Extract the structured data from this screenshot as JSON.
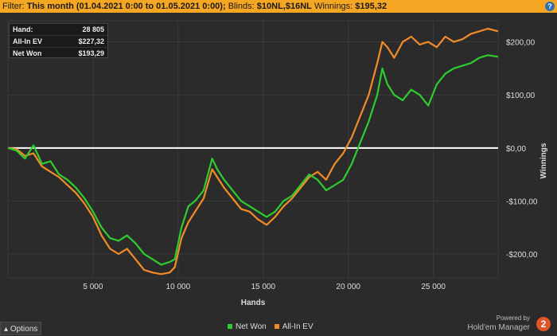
{
  "filter": {
    "prefix": "Filter:",
    "month": "This month (01.04.2021 0:00 to 01.05.2021 0:00);",
    "blinds_label": "Blinds:",
    "blinds": "$10NL,$16NL",
    "winnings_label": "Winnings:",
    "winnings": "$195,32",
    "help_icon": "?"
  },
  "stats": {
    "hands_label": "Hand:",
    "hands_value": "28 805",
    "allin_label": "All-In EV",
    "allin_value": "$227,32",
    "netwon_label": "Net Won",
    "netwon_value": "$193,29"
  },
  "options_label": "Options",
  "branding": {
    "line1": "Powered by",
    "line2": "Hold'em Manager",
    "logo": "2"
  },
  "colors": {
    "net_won": "#2ecc2e",
    "allin_ev": "#f28c28",
    "zero_line": "#ffffff",
    "filter_bar": "#f5a623"
  },
  "chart_data": {
    "type": "line",
    "xlabel": "Hands",
    "ylabel": "Winnings",
    "x_ticks": [
      "5 000",
      "10 000",
      "15 000",
      "20 000",
      "25 000"
    ],
    "x_tick_values": [
      5000,
      10000,
      15000,
      20000,
      25000
    ],
    "y_ticks": [
      "$200,00",
      "$100,00",
      "$0,00",
      "-$100,00",
      "-$200,00"
    ],
    "y_tick_values": [
      200,
      100,
      0,
      -100,
      -200
    ],
    "xlim": [
      0,
      28805
    ],
    "ylim": [
      -245,
      240
    ],
    "grid": true,
    "legend": "bottom-center",
    "series": [
      {
        "name": "Net Won",
        "color": "#2ecc2e",
        "x": [
          0,
          500,
          1000,
          1500,
          2000,
          2500,
          3000,
          3500,
          4000,
          4500,
          5000,
          5500,
          6000,
          6500,
          7000,
          7500,
          8000,
          8500,
          9000,
          9500,
          9800,
          10200,
          10600,
          11000,
          11500,
          12000,
          12300,
          12700,
          13200,
          13700,
          14200,
          14700,
          15200,
          15700,
          16200,
          16700,
          17200,
          17700,
          18200,
          18700,
          19200,
          19700,
          20200,
          20700,
          21200,
          21700,
          22000,
          22300,
          22700,
          23200,
          23700,
          24200,
          24700,
          25200,
          25700,
          26200,
          26700,
          27200,
          27700,
          28200,
          28805
        ],
        "y": [
          0,
          -5,
          -20,
          5,
          -30,
          -25,
          -50,
          -60,
          -75,
          -95,
          -120,
          -150,
          -170,
          -175,
          -165,
          -180,
          -200,
          -210,
          -220,
          -215,
          -210,
          -150,
          -110,
          -100,
          -80,
          -20,
          -40,
          -60,
          -80,
          -100,
          -110,
          -120,
          -130,
          -120,
          -100,
          -90,
          -70,
          -50,
          -60,
          -80,
          -70,
          -60,
          -30,
          10,
          50,
          100,
          150,
          120,
          100,
          90,
          110,
          100,
          80,
          120,
          140,
          150,
          155,
          160,
          170,
          175,
          172
        ]
      },
      {
        "name": "All-In EV",
        "color": "#f28c28",
        "x": [
          0,
          500,
          1000,
          1500,
          2000,
          2500,
          3000,
          3500,
          4000,
          4500,
          5000,
          5500,
          6000,
          6500,
          7000,
          7500,
          8000,
          8500,
          9000,
          9500,
          9800,
          10200,
          10600,
          11000,
          11500,
          12000,
          12300,
          12700,
          13200,
          13700,
          14200,
          14700,
          15200,
          15700,
          16200,
          16700,
          17200,
          17700,
          18200,
          18700,
          19200,
          19700,
          20200,
          20700,
          21200,
          21700,
          22000,
          22300,
          22700,
          23200,
          23700,
          24200,
          24700,
          25200,
          25700,
          26200,
          26700,
          27200,
          27700,
          28200,
          28805
        ],
        "y": [
          0,
          -2,
          -15,
          -10,
          -35,
          -45,
          -55,
          -70,
          -85,
          -105,
          -130,
          -165,
          -190,
          -200,
          -190,
          -210,
          -230,
          -235,
          -238,
          -235,
          -225,
          -170,
          -140,
          -120,
          -95,
          -40,
          -55,
          -75,
          -95,
          -115,
          -120,
          -135,
          -145,
          -130,
          -110,
          -95,
          -75,
          -55,
          -45,
          -60,
          -30,
          -10,
          20,
          60,
          100,
          160,
          200,
          190,
          170,
          200,
          210,
          195,
          200,
          190,
          210,
          200,
          205,
          215,
          220,
          225,
          220
        ]
      }
    ]
  }
}
